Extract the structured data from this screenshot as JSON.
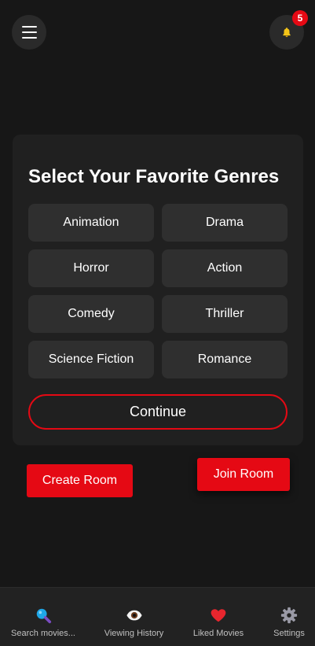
{
  "header": {
    "menu_icon": "hamburger-icon",
    "notification_icon": "bell-icon",
    "notification_count": "5"
  },
  "genre_card": {
    "title": "Select Your Favorite Genres",
    "genres": [
      "Animation",
      "Drama",
      "Horror",
      "Action",
      "Comedy",
      "Thriller",
      "Science Fiction",
      "Romance"
    ],
    "continue_label": "Continue"
  },
  "rooms": {
    "create_label": "Create Room",
    "join_label": "Join Room"
  },
  "bottom_nav": {
    "items": [
      {
        "label": "Search movies...",
        "icon": "search-icon"
      },
      {
        "label": "Viewing History",
        "icon": "eye-icon"
      },
      {
        "label": "Liked Movies",
        "icon": "heart-icon"
      },
      {
        "label": "Settings",
        "icon": "gear-icon"
      }
    ]
  },
  "colors": {
    "background": "#171717",
    "card": "#202020",
    "accent": "#e50914",
    "genre_button": "#2f2f2f"
  }
}
